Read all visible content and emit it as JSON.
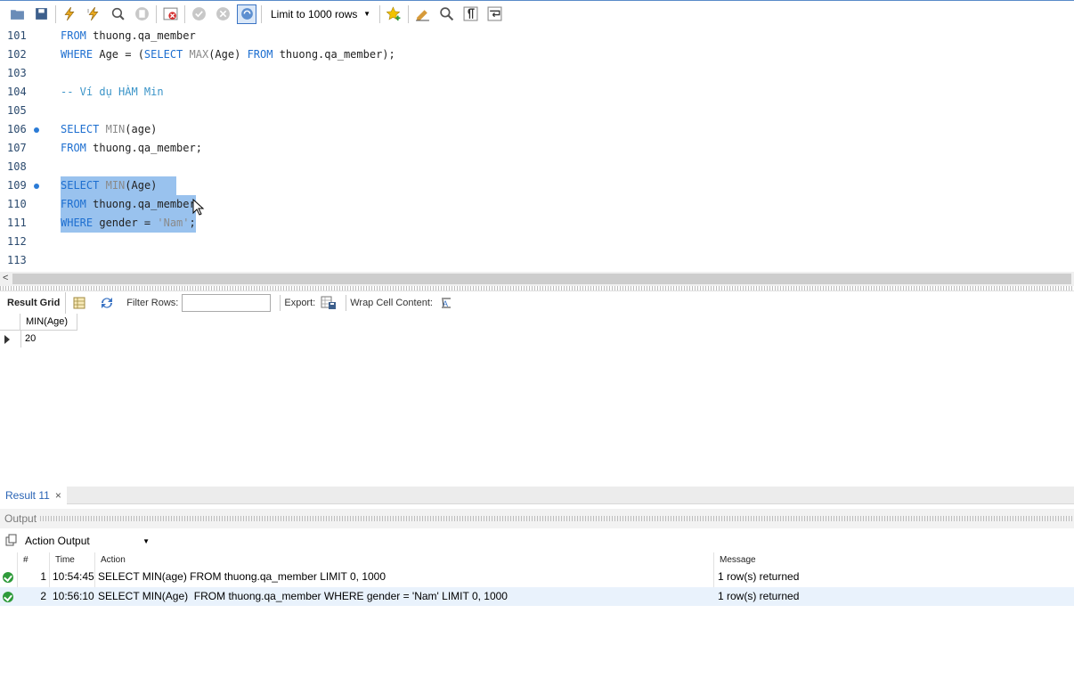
{
  "toolbar": {
    "limit_label": "Limit to 1000 rows",
    "icons": [
      "open-folder-icon",
      "save-icon",
      "execute-icon",
      "execute-current-icon",
      "explain-icon",
      "stop-icon",
      "toggle-error-icon",
      "commit-icon",
      "rollback-icon",
      "autocommit-icon",
      "bookmark-icon",
      "beautify-icon",
      "find-icon",
      "invisible-chars-icon",
      "wrap-icon"
    ]
  },
  "editor": {
    "lines": [
      {
        "n": "101",
        "tokens": [
          [
            "kw",
            "FROM"
          ],
          [
            "t",
            " thuong.qa_member"
          ]
        ]
      },
      {
        "n": "102",
        "tokens": [
          [
            "kw",
            "WHERE"
          ],
          [
            "t",
            " Age = ("
          ],
          [
            "kw",
            "SELECT"
          ],
          [
            "t",
            " "
          ],
          [
            "fn",
            "MAX"
          ],
          [
            "t",
            "(Age) "
          ],
          [
            "kw",
            "FROM"
          ],
          [
            "t",
            " thuong.qa_member);"
          ]
        ]
      },
      {
        "n": "103",
        "tokens": []
      },
      {
        "n": "104",
        "tokens": [
          [
            "cm",
            "-- Ví dụ HÀM Min"
          ]
        ]
      },
      {
        "n": "105",
        "tokens": []
      },
      {
        "n": "106",
        "bp": true,
        "tokens": [
          [
            "kw",
            "SELECT"
          ],
          [
            "t",
            " "
          ],
          [
            "fn",
            "MIN"
          ],
          [
            "t",
            "(age)"
          ]
        ]
      },
      {
        "n": "107",
        "tokens": [
          [
            "kw",
            "FROM"
          ],
          [
            "t",
            " thuong.qa_member;"
          ]
        ]
      },
      {
        "n": "108",
        "tokens": []
      },
      {
        "n": "109",
        "bp": true,
        "sel": "SELECT MIN(Age)   ",
        "tokens": [
          [
            "kw",
            "SELECT"
          ],
          [
            "t",
            " "
          ],
          [
            "fn",
            "MIN"
          ],
          [
            "t",
            "(Age)   "
          ]
        ]
      },
      {
        "n": "110",
        "sel": true,
        "tokens": [
          [
            "kw",
            "FROM"
          ],
          [
            "t",
            " thuong.qa_member"
          ]
        ]
      },
      {
        "n": "111",
        "sel": true,
        "tokens": [
          [
            "kw",
            "WHERE"
          ],
          [
            "t",
            " gender = "
          ],
          [
            "str",
            "'Nam'"
          ],
          [
            "t",
            ";"
          ]
        ]
      },
      {
        "n": "112",
        "tokens": []
      },
      {
        "n": "113",
        "tokens": []
      }
    ]
  },
  "result_toolbar": {
    "tab_label": "Result Grid",
    "filter_label": "Filter Rows:",
    "filter_value": "",
    "export_label": "Export:",
    "wrap_label": "Wrap Cell Content:"
  },
  "grid": {
    "columns": [
      "MIN(Age)"
    ],
    "rows": [
      [
        "20"
      ]
    ]
  },
  "result_tab": {
    "label": "Result 11",
    "close": "×"
  },
  "output": {
    "title": "Output",
    "selector": "Action Output",
    "headers": {
      "num": "#",
      "time": "Time",
      "action": "Action",
      "message": "Message"
    },
    "rows": [
      {
        "num": "1",
        "time": "10:54:45",
        "action": "SELECT MIN(age) FROM thuong.qa_member LIMIT 0, 1000",
        "message": "1 row(s) returned"
      },
      {
        "num": "2",
        "time": "10:56:10",
        "action": "SELECT MIN(Age)  FROM thuong.qa_member WHERE gender = 'Nam' LIMIT 0, 1000",
        "message": "1 row(s) returned"
      }
    ]
  }
}
